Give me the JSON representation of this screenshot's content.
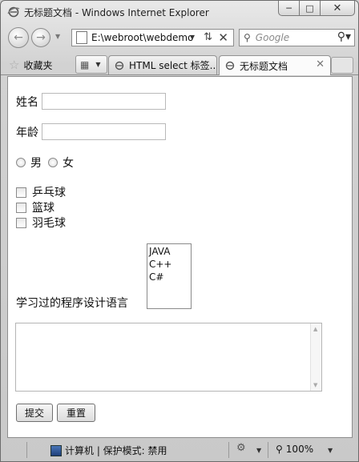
{
  "window": {
    "title": "无标题文档 - Windows Internet Explorer"
  },
  "toolbar": {
    "address": "E:\\webroot\\webdemo",
    "search_placeholder": "Google"
  },
  "tabs": {
    "favorites_label": "收藏夹",
    "items": [
      {
        "label": "HTML select 标签..."
      },
      {
        "label": "无标题文档"
      }
    ]
  },
  "form": {
    "name_label": "姓名",
    "name_value": "",
    "age_label": "年龄",
    "age_value": "",
    "gender_male": "男",
    "gender_female": "女",
    "hobbies": [
      "乒乓球",
      "篮球",
      "羽毛球"
    ],
    "language_label": "学习过的程序设计语言",
    "language_options": [
      "JAVA",
      "C++",
      "C#"
    ],
    "comment_value": "",
    "submit_label": "提交",
    "reset_label": "重置"
  },
  "statusbar": {
    "zone": "计算机 | 保护模式: 禁用",
    "zoom": "100%"
  }
}
